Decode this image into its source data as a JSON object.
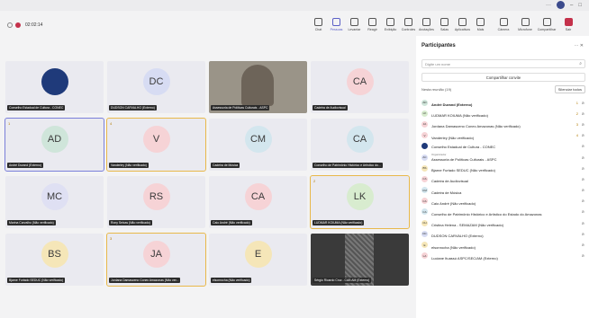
{
  "toolbar": {
    "time": "02:02:14",
    "tools": [
      {
        "label": "Chat",
        "icon": "chat-icon",
        "active": false
      },
      {
        "label": "Pessoas",
        "icon": "people-icon",
        "active": true
      },
      {
        "label": "Levantar",
        "icon": "raise-hand-icon",
        "active": false
      },
      {
        "label": "Reagir",
        "icon": "react-icon",
        "active": false
      },
      {
        "label": "Exibição",
        "icon": "view-icon",
        "active": false
      },
      {
        "label": "Controles",
        "icon": "controls-icon",
        "active": false
      },
      {
        "label": "Anotações",
        "icon": "notes-icon",
        "active": false
      },
      {
        "label": "Salas",
        "icon": "rooms-icon",
        "active": false
      },
      {
        "label": "Aplicativos",
        "icon": "apps-icon",
        "active": false
      },
      {
        "label": "Mais",
        "icon": "more-icon",
        "active": false
      }
    ],
    "device_tools": [
      {
        "label": "Câmera",
        "icon": "camera-icon"
      },
      {
        "label": "Microfone",
        "icon": "microphone-icon"
      },
      {
        "label": "Compartilhar",
        "icon": "share-icon"
      },
      {
        "label": "Sair",
        "icon": "leave-icon"
      }
    ]
  },
  "tiles": [
    {
      "initials": "",
      "name": "Conselho Estadual de Cultura - CONEC",
      "bg": "#1f3a7a",
      "kind": "logo",
      "hand": ""
    },
    {
      "initials": "DC",
      "name": "DUDSON CARVALHO (Externo)",
      "bg": "#d7dcf3",
      "kind": "avatar",
      "hand": ""
    },
    {
      "initials": "",
      "name": "Assessoria de Políticas Culturais - ASPC",
      "bg": "",
      "kind": "photo",
      "hand": ""
    },
    {
      "initials": "CA",
      "name": "Cadeira de Audiovisual",
      "bg": "#f6d3d6",
      "kind": "avatar",
      "hand": ""
    },
    {
      "initials": "AD",
      "name": "André Durand (Externo)",
      "bg": "#cfe5da",
      "kind": "avatar",
      "hand": "1",
      "style": "sel"
    },
    {
      "initials": "V",
      "name": "Vanderley (Não verificado)",
      "bg": "#f6d3d6",
      "kind": "avatar",
      "hand": "4",
      "style": "hl"
    },
    {
      "initials": "CM",
      "name": "Cadeira de Música",
      "bg": "#d3e6ee",
      "kind": "avatar",
      "hand": ""
    },
    {
      "initials": "CA",
      "name": "Conselho de Patrimônio Histórico e Artístico do...",
      "bg": "#d3e6ee",
      "kind": "avatar",
      "hand": ""
    },
    {
      "initials": "MC",
      "name": "Marina Carvalho (Não verificado)",
      "bg": "#dfe0f3",
      "kind": "avatar",
      "hand": ""
    },
    {
      "initials": "RS",
      "name": "Rony Seixas (Não verificado)",
      "bg": "#f6d3d6",
      "kind": "avatar",
      "hand": ""
    },
    {
      "initials": "CA",
      "name": "Caio André (Não verificado)",
      "bg": "#f6d3d6",
      "kind": "avatar",
      "hand": ""
    },
    {
      "initials": "LK",
      "name": "LUDMAR KOIUMA (Não verificado)",
      "bg": "#d8eccf",
      "kind": "avatar",
      "hand": "2",
      "style": "hl"
    },
    {
      "initials": "BS",
      "name": "Bjarne Furtado SEDUC (Não verificado)",
      "bg": "#f5e6b8",
      "kind": "avatar",
      "hand": ""
    },
    {
      "initials": "JA",
      "name": "Jordana Damasceno Conec Amazonas (Não ver...",
      "bg": "#f6d3d6",
      "kind": "avatar",
      "hand": "3",
      "style": "hl"
    },
    {
      "initials": "E",
      "name": "elsonrocha (Não verificado)",
      "bg": "#f5e6b8",
      "kind": "avatar",
      "hand": ""
    },
    {
      "initials": "",
      "name": "Sérgio Ricardo Cruz - CAB AM (Externo)",
      "bg": "",
      "kind": "dark",
      "hand": ""
    }
  ],
  "panel": {
    "title": "Participantes",
    "search_placeholder": "Digite um nome",
    "share_label": "Compartilhar convite",
    "section_label": "Nesta reunião (19)",
    "mute_all": "Silenciar todos",
    "participants": [
      {
        "initials": "AD",
        "name": "André Durand (Externo)",
        "sub": "",
        "bg": "#cfe5da",
        "hand": "1",
        "bold": true
      },
      {
        "initials": "LK",
        "name": "LUDMAR KOIUMA (Não verificado)",
        "sub": "",
        "bg": "#d8eccf",
        "hand": "2"
      },
      {
        "initials": "JA",
        "name": "Jordana Damasceno Conec Amazonas (Não verificado)",
        "sub": "",
        "bg": "#f6d3d6",
        "hand": "3"
      },
      {
        "initials": "V",
        "name": "Vanderley (Não verificado)",
        "sub": "",
        "bg": "#f6d3d6",
        "hand": "4"
      },
      {
        "initials": "",
        "name": "Conselho Estadual de Cultura - CONEC",
        "sub": "Organizador",
        "bg": "#1f3a7a",
        "hand": ""
      },
      {
        "initials": "AC",
        "name": "Assessoria de Políticas Culturais - ASPC",
        "sub": "",
        "bg": "#d7dcf3",
        "hand": ""
      },
      {
        "initials": "BS",
        "name": "Bjarne Furtado SEDUC (Não verificado)",
        "sub": "",
        "bg": "#f5e6b8",
        "hand": ""
      },
      {
        "initials": "CA",
        "name": "Cadeira de Audiovisual",
        "sub": "",
        "bg": "#f6d3d6",
        "hand": ""
      },
      {
        "initials": "CM",
        "name": "Cadeira de Música",
        "sub": "",
        "bg": "#d3e6ee",
        "hand": ""
      },
      {
        "initials": "CA",
        "name": "Caio André (Não verificado)",
        "sub": "",
        "bg": "#f6d3d6",
        "hand": ""
      },
      {
        "initials": "CA",
        "name": "Conselho de Patrimônio Histórico e Artístico do Estado do Amazonas",
        "sub": "",
        "bg": "#d3e6ee",
        "hand": ""
      },
      {
        "initials": "CH",
        "name": "Cristina Helena - SEMAZAM (Não verificado)",
        "sub": "",
        "bg": "#f5e6b8",
        "hand": ""
      },
      {
        "initials": "DC",
        "name": "DUDSON CARVALHO (Externo)",
        "sub": "",
        "bg": "#d7dcf3",
        "hand": ""
      },
      {
        "initials": "E",
        "name": "elsonrocha (Não verificado)",
        "sub": "",
        "bg": "#f5e6b8",
        "hand": ""
      },
      {
        "initials": "LA",
        "name": "Luciane Ituassú ASPC/SEC/AM (Externo)",
        "sub": "",
        "bg": "#f6d3d6",
        "hand": ""
      }
    ]
  }
}
